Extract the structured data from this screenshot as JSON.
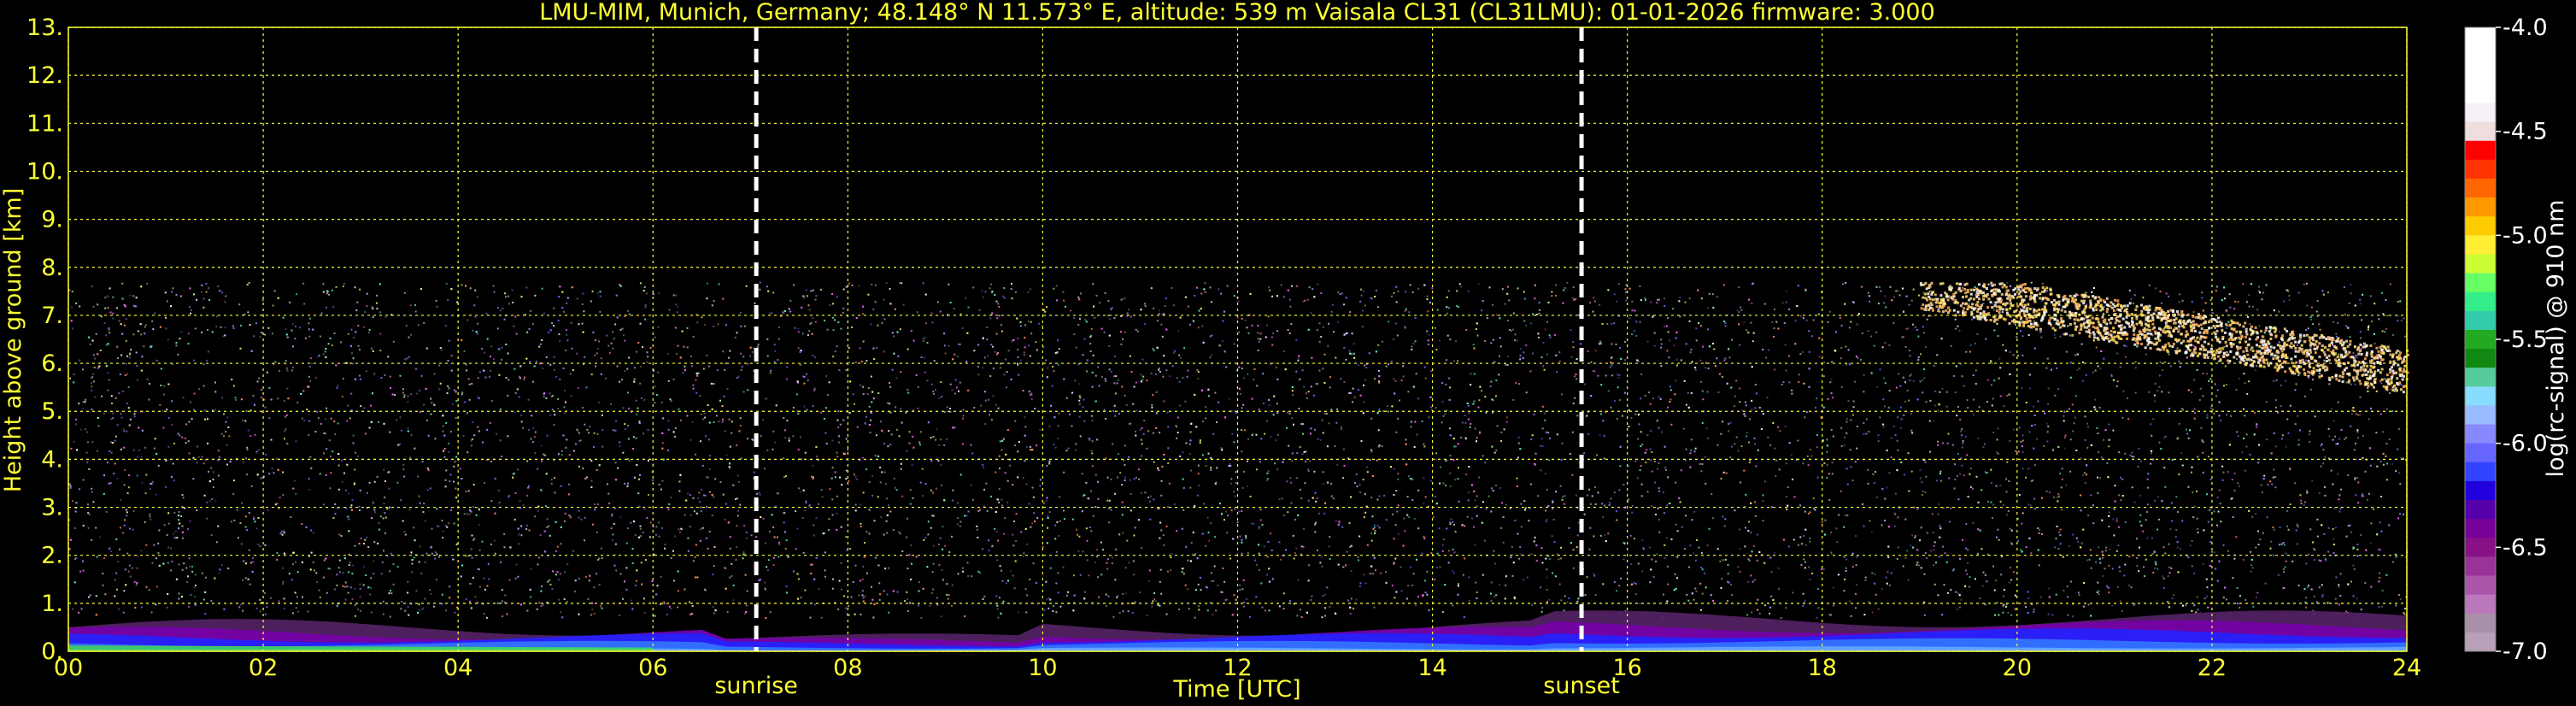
{
  "chart_data": {
    "type": "heatmap",
    "title": "LMU-MIM, Munich, Germany; 48.148° N 11.573° E, altitude: 539 m    Vaisala CL31 (CL31LMU): 01-01-2026    firmware: 3.000",
    "xlabel": "Time [UTC]",
    "ylabel": "Height above ground [km]",
    "xlim": [
      0,
      24
    ],
    "ylim": [
      0,
      13
    ],
    "x_ticks": [
      "00",
      "02",
      "04",
      "06",
      "08",
      "10",
      "12",
      "14",
      "16",
      "18",
      "20",
      "22",
      "24"
    ],
    "y_ticks": [
      "0.",
      "1.",
      "2.",
      "3.",
      "4.",
      "5.",
      "6.",
      "7.",
      "8.",
      "9.",
      "10.",
      "11.",
      "12.",
      "13."
    ],
    "grid": true,
    "markers": [
      {
        "label": "sunrise",
        "x": 7.06
      },
      {
        "label": "sunset",
        "x": 15.53
      }
    ],
    "signal_top_km": 7.7,
    "colorbar": {
      "label": "log(rc-signal) @ 910 nm",
      "range": [
        -7.0,
        -4.0
      ],
      "ticks": [
        "-4.0",
        "-4.5",
        "-5.0",
        "-5.5",
        "-6.0",
        "-6.5",
        "-7.0"
      ]
    }
  },
  "colors": {
    "text": "#ffff33",
    "grid": "#ffff33",
    "background": "#000000",
    "markers": "#ffffff"
  }
}
